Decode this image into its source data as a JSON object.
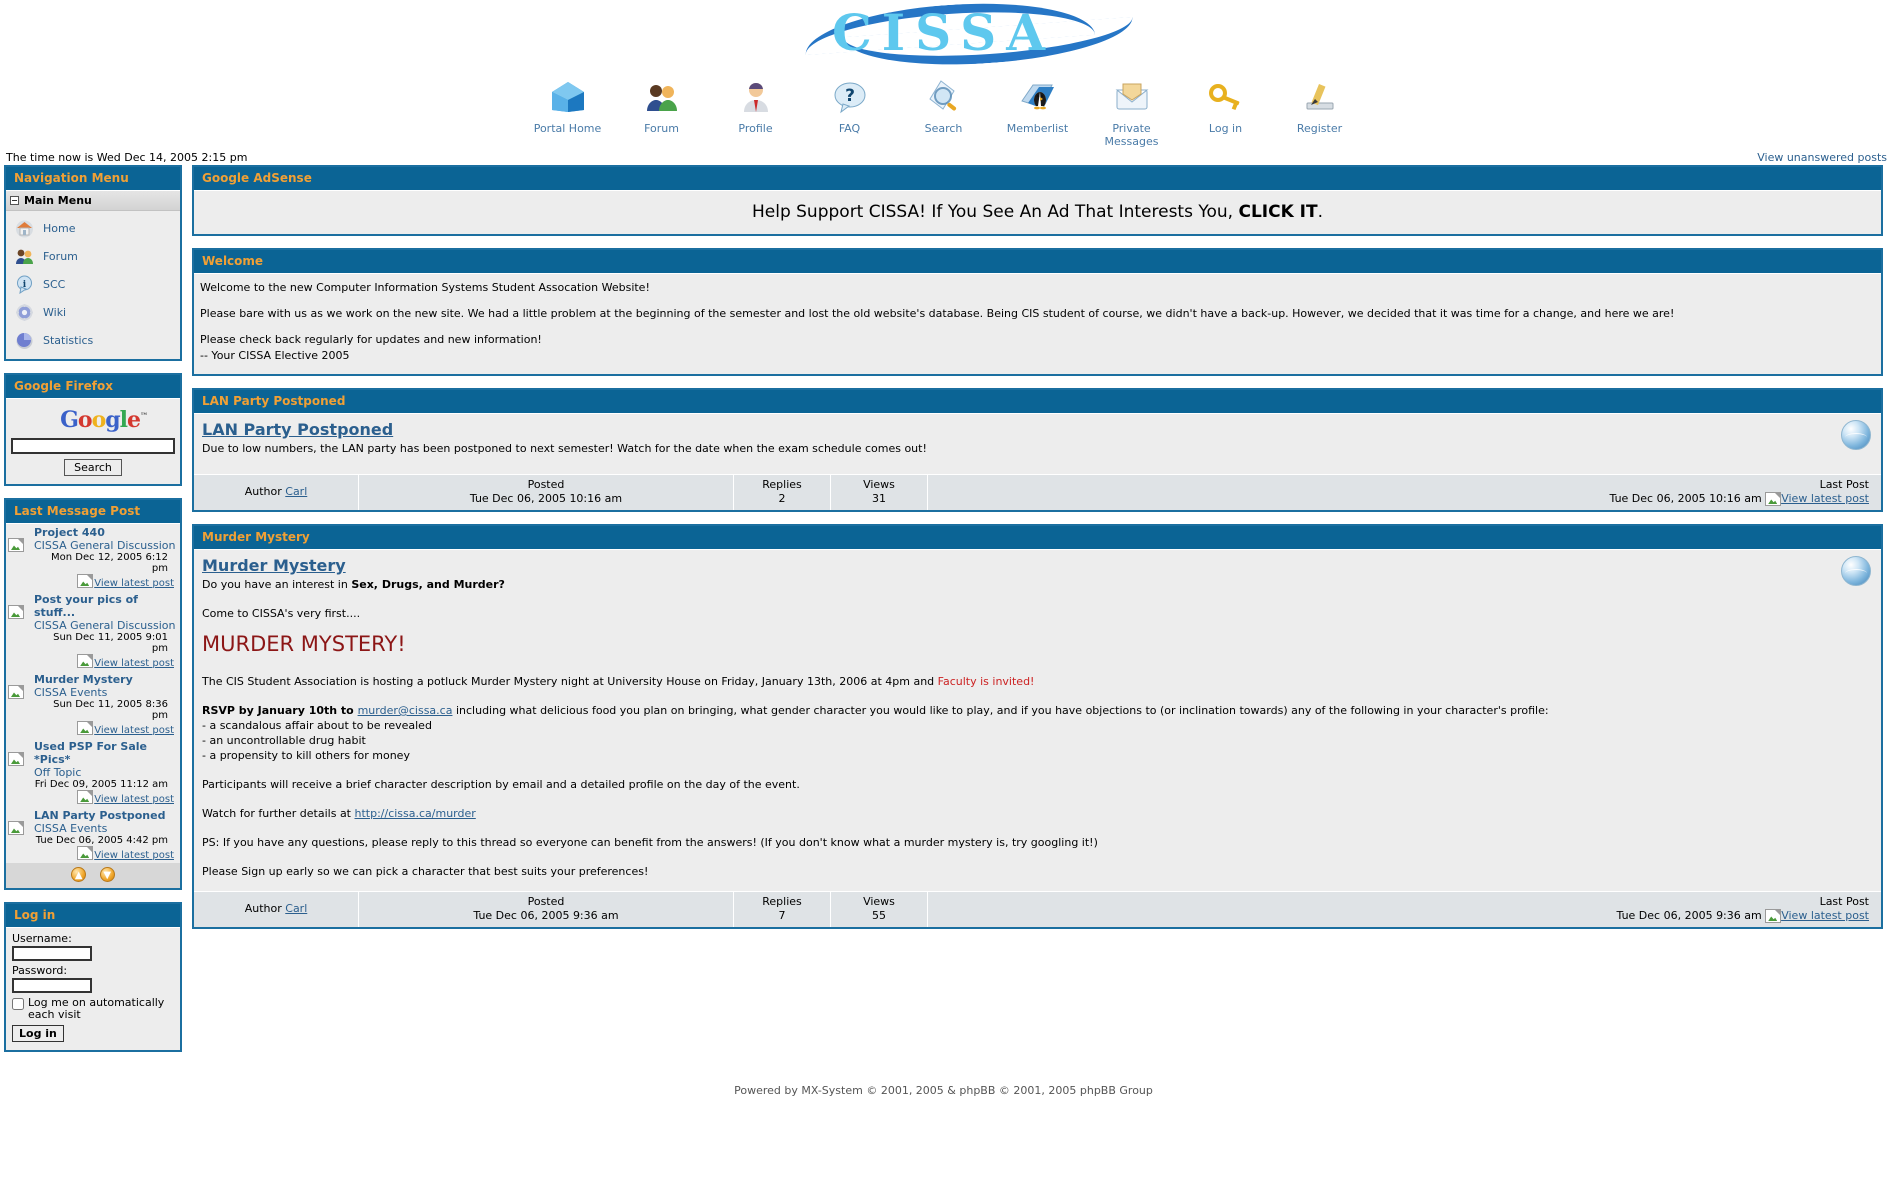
{
  "site": {
    "logo_text": "CISSA",
    "time_now": "The time now is Wed Dec 14, 2005 2:15 pm",
    "unanswered_link": "View unanswered posts"
  },
  "topnav": [
    {
      "icon": "home-icon",
      "label": "Portal Home"
    },
    {
      "icon": "people-forum-icon",
      "label": "Forum"
    },
    {
      "icon": "person-profile-icon",
      "label": "Profile"
    },
    {
      "icon": "question-bubble-icon",
      "label": "FAQ"
    },
    {
      "icon": "magnifier-search-icon",
      "label": "Search"
    },
    {
      "icon": "penguin-memberlist-icon",
      "label": "Memberlist"
    },
    {
      "icon": "envelope-icon",
      "label": "Private Messages"
    },
    {
      "icon": "key-icon",
      "label": "Log in"
    },
    {
      "icon": "pencil-register-icon",
      "label": "Register"
    }
  ],
  "sidebar": {
    "nav": {
      "title": "Navigation Menu",
      "group_label": "Main Menu",
      "items": [
        {
          "icon": "house-icon",
          "label": "Home"
        },
        {
          "icon": "users-icon",
          "label": "Forum"
        },
        {
          "icon": "info-icon",
          "label": "SCC"
        },
        {
          "icon": "gear-icon",
          "label": "Wiki"
        },
        {
          "icon": "pie-chart-icon",
          "label": "Statistics"
        }
      ]
    },
    "google": {
      "title": "Google Firefox",
      "logo": {
        "g1": "G",
        "o1": "o",
        "o2": "o",
        "g2": "g",
        "l": "l",
        "e": "e",
        "tm": "™"
      },
      "input_value": "",
      "input_placeholder": "",
      "button_label": "Search"
    },
    "last_posts": {
      "title": "Last Message Post",
      "view_label": "View latest post",
      "items": [
        {
          "title": "Project 440",
          "forum": "CISSA General Discussion",
          "date": "Mon Dec 12, 2005 6:12 pm"
        },
        {
          "title": "Post your pics of stuff...",
          "forum": "CISSA General Discussion",
          "date": "Sun Dec 11, 2005 9:01 pm"
        },
        {
          "title": "Murder Mystery",
          "forum": "CISSA Events",
          "date": "Sun Dec 11, 2005 8:36 pm"
        },
        {
          "title": "Used PSP For Sale *Pics*",
          "forum": "Off Topic",
          "date": "Fri Dec 09, 2005 11:12 am"
        },
        {
          "title": "LAN Party Postponed",
          "forum": "CISSA Events",
          "date": "Tue Dec 06, 2005 4:42 pm"
        }
      ]
    },
    "login": {
      "title": "Log in",
      "username_label": "Username:",
      "username_value": "",
      "password_label": "Password:",
      "password_value": "",
      "remember_label": "Log me on automatically each visit",
      "button_label": "Log in"
    }
  },
  "main": {
    "adsense": {
      "title": "Google AdSense",
      "text_before": "Help Support CISSA! If You See An Ad That Interests You, ",
      "text_bold": "CLICK IT",
      "text_after": "."
    },
    "welcome": {
      "title": "Welcome",
      "p1": "Welcome to the new Computer Information Systems Student Assocation Website!",
      "p2": "Please bare with us as we work on the new site. We had a little problem at the beginning of the semester and lost the old website's database. Being CIS student of course, we didn't have a back-up. However, we decided that it was time for a change, and here we are!",
      "p3a": "Please check back regularly for updates and new information!",
      "p3b": "-- Your CISSA Elective 2005"
    },
    "lan_party": {
      "panel_title": "LAN Party Postponed",
      "post_title": "LAN Party Postponed",
      "body": "Due to low numbers, the LAN party has been postponed to next semester! Watch for the date when the exam schedule comes out!",
      "footer": {
        "author_label": "Author",
        "author_name": "Carl",
        "posted_head": "Posted",
        "posted_val": "Tue Dec 06, 2005 10:16 am",
        "replies_head": "Replies",
        "replies_val": "2",
        "views_head": "Views",
        "views_val": "31",
        "last_head": "Last Post",
        "last_val": "Tue Dec 06, 2005 10:16 am",
        "view_label": "View latest post"
      }
    },
    "murder_mystery": {
      "panel_title": "Murder Mystery",
      "post_title": "Murder Mystery",
      "line1_a": "Do you have an interest in ",
      "line1_b": "Sex, Drugs, and Murder?",
      "line2": "Come to CISSA's very first....",
      "headline": "MURDER MYSTERY!",
      "para1_a": "The CIS Student Association is hosting a potluck Murder Mystery night at University House on Friday, January 13th, 2006 at 4pm and ",
      "para1_b": "Faculty is invited!",
      "rsvp_a": "RSVP by January 10th to ",
      "rsvp_email": "murder@cissa.ca",
      "rsvp_b": " including what delicious food you plan on bringing, what gender character you would like to play, and if you have objections to (or inclination towards) any of the following in your character's profile:",
      "bullets": [
        "- a scandalous affair about to be revealed",
        "- an uncontrollable drug habit",
        "- a propensity to kill others for money"
      ],
      "para2": "Participants will receive a brief character description by email and a detailed profile on the day of the event.",
      "para3_a": "Watch for further details at ",
      "para3_link": "http://cissa.ca/murder",
      "para4": "PS: If you have any questions, please reply to this thread so everyone can benefit from the answers! (If you don't know what a murder mystery is, try googling it!)",
      "para5": "Please Sign up early so we can pick a character that best suits your preferences!",
      "footer": {
        "author_label": "Author",
        "author_name": "Carl",
        "posted_head": "Posted",
        "posted_val": "Tue Dec 06, 2005 9:36 am",
        "replies_head": "Replies",
        "replies_val": "7",
        "views_head": "Views",
        "views_val": "55",
        "last_head": "Last Post",
        "last_val": "Tue Dec 06, 2005 9:36 am",
        "view_label": "View latest post"
      }
    }
  },
  "footer": {
    "text": "Powered by MX-System © 2001, 2005 & phpBB © 2001, 2005 phpBB Group"
  },
  "colors": {
    "panel_header_bg": "#0b6495",
    "panel_header_text": "#f0a035",
    "panel_border": "#1b6fa0",
    "body_bg": "#ededed",
    "link": "#2b5f8e",
    "headline_red": "#8c1616",
    "logo_blue": "#5ec8ee"
  }
}
